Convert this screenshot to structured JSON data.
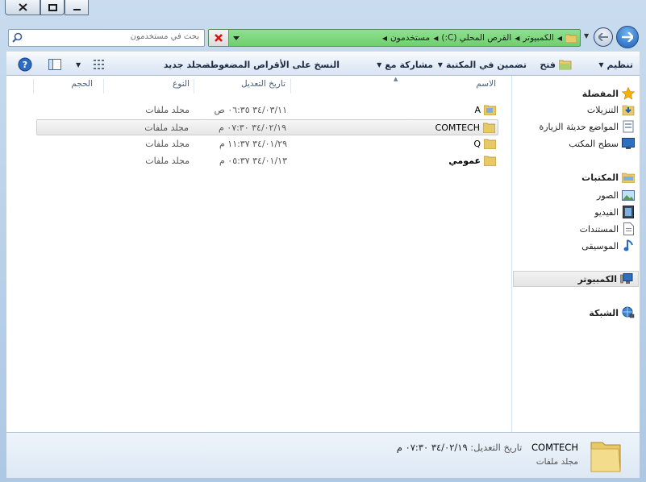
{
  "window": {
    "caption": {
      "close": "✕",
      "minimize": "□",
      "maximize": "▭"
    }
  },
  "address": {
    "crumbs": [
      "الكمبيوتر",
      "القرص المحلي (C:)",
      "مستخدمون"
    ],
    "colors": {
      "bar": "#7cd67c"
    }
  },
  "search": {
    "placeholder": "بحث في مستخدمون"
  },
  "toolbar": {
    "organize": "تنظيم",
    "open": "فتح",
    "include_library": "تضمين في المكتبة",
    "share_with": "مشاركة مع",
    "burn": "النسخ على الأقراص المضغوطة",
    "new_folder": "مجلد جديد"
  },
  "nav": {
    "favorites": {
      "title": "المفضلة",
      "items": [
        "التنزيلات",
        "المواضع حديثة الزيارة",
        "سطح المكتب"
      ]
    },
    "libraries": {
      "title": "المكتبات",
      "items": [
        "الصور",
        "الفيديو",
        "المستندات",
        "الموسيقى"
      ]
    },
    "computer": "الكمبيوتر",
    "network": "الشبكة"
  },
  "columns": {
    "name": "الاسم",
    "date": "تاريخ التعديل",
    "type": "النوع",
    "size": "الحجم"
  },
  "files": [
    {
      "name": "A",
      "date": "٣٤/٠٣/١١ ٠٦:٣٥ ص",
      "type": "مجلد ملفات"
    },
    {
      "name": "COMTECH",
      "date": "٣٤/٠٢/١٩ ٠٧:٣٠ م",
      "type": "مجلد ملفات"
    },
    {
      "name": "Q",
      "date": "٣٤/٠١/٢٩ ١١:٣٧ م",
      "type": "مجلد ملفات"
    },
    {
      "name": "عمومي",
      "date": "٣٤/٠١/١٣ ٠٥:٣٧ م",
      "type": "مجلد ملفات"
    }
  ],
  "details": {
    "name": "COMTECH",
    "modified_label": "تاريخ التعديل:",
    "modified_value": "٣٤/٠٢/١٩ ٠٧:٣٠ م",
    "type": "مجلد ملفات"
  },
  "colors": {
    "folder": "#e8c96a",
    "accent": "#1c5fb5",
    "star": "#f5b400"
  }
}
